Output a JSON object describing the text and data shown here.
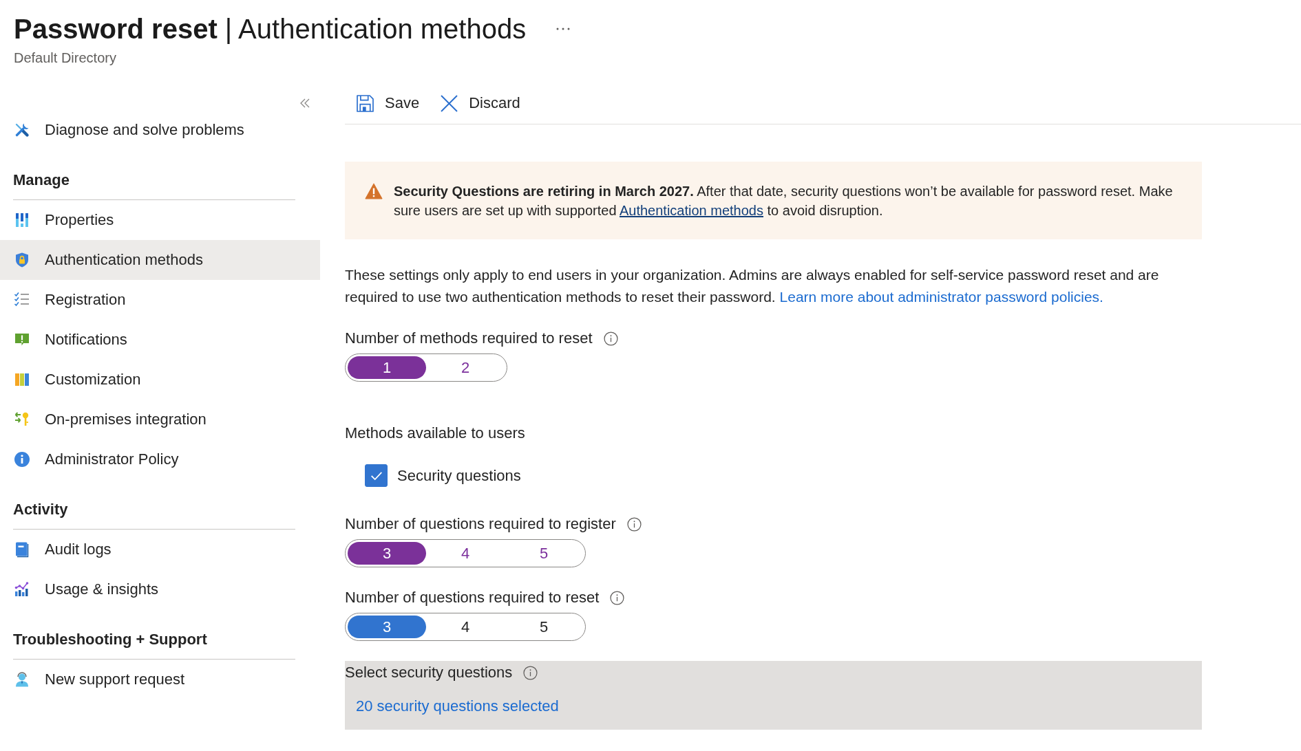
{
  "header": {
    "title": "**Password reset** | Authentication methods",
    "subtitle": "Default Directory"
  },
  "sidebar": {
    "items": [
      {
        "kind": "link",
        "label": "Diagnose and solve problems",
        "selected": false
      },
      {
        "kind": "heading",
        "label": "Manage"
      },
      {
        "kind": "link",
        "label": "Properties",
        "selected": false
      },
      {
        "kind": "link",
        "label": "Authentication methods",
        "selected": true
      },
      {
        "kind": "link",
        "label": "Registration",
        "selected": false
      },
      {
        "kind": "link",
        "label": "Notifications",
        "selected": false
      },
      {
        "kind": "link",
        "label": "Customization",
        "selected": false
      },
      {
        "kind": "link",
        "label": "On-premises integration",
        "selected": false
      },
      {
        "kind": "link",
        "label": "Administrator Policy",
        "selected": false
      },
      {
        "kind": "heading",
        "label": "Activity"
      },
      {
        "kind": "link",
        "label": "Audit logs",
        "selected": false
      },
      {
        "kind": "link",
        "label": "Usage & insights",
        "selected": false
      },
      {
        "kind": "heading",
        "label": "Troubleshooting + Support"
      },
      {
        "kind": "link",
        "label": "New support request",
        "selected": false
      }
    ]
  },
  "toolbar": {
    "buttons": [
      {
        "label": "Save"
      },
      {
        "label": "Discard"
      }
    ]
  },
  "banner": {
    "kind": "warning",
    "text": "**Security Questions are retiring in March 2027.** After that date, security questions won’t be available for password reset. Make sure users are set up with supported",
    "link": "Authentication methods",
    "text_after": "to avoid disruption."
  },
  "description": {
    "text": "These settings only apply to end users in your organization. Admins are always enabled for self-service password reset and are required to use two authentication methods to reset their password.",
    "link": "Learn more about administrator password policies."
  },
  "settings": [
    {
      "kind": "segmented",
      "label": "Number of methods required to reset",
      "modified": true,
      "options": [
        {
          "label": "1",
          "selected": true
        },
        {
          "label": "2",
          "selected": false
        }
      ]
    },
    {
      "kind": "checklist",
      "label": "Methods available to users",
      "options": [
        {
          "label": "Security questions",
          "checked": true
        }
      ]
    },
    {
      "kind": "segmented",
      "label": "Number of questions required to register",
      "modified": true,
      "options": [
        {
          "label": "3",
          "selected": true
        },
        {
          "label": "4",
          "selected": false
        },
        {
          "label": "5",
          "selected": false
        }
      ]
    },
    {
      "kind": "segmented",
      "label": "Number of questions required to reset",
      "modified": false,
      "options": [
        {
          "label": "3",
          "selected": true
        },
        {
          "label": "4",
          "selected": false
        },
        {
          "label": "5",
          "selected": false
        }
      ]
    },
    {
      "kind": "picker",
      "label": "Select security questions",
      "link": "20 security questions selected"
    }
  ]
}
